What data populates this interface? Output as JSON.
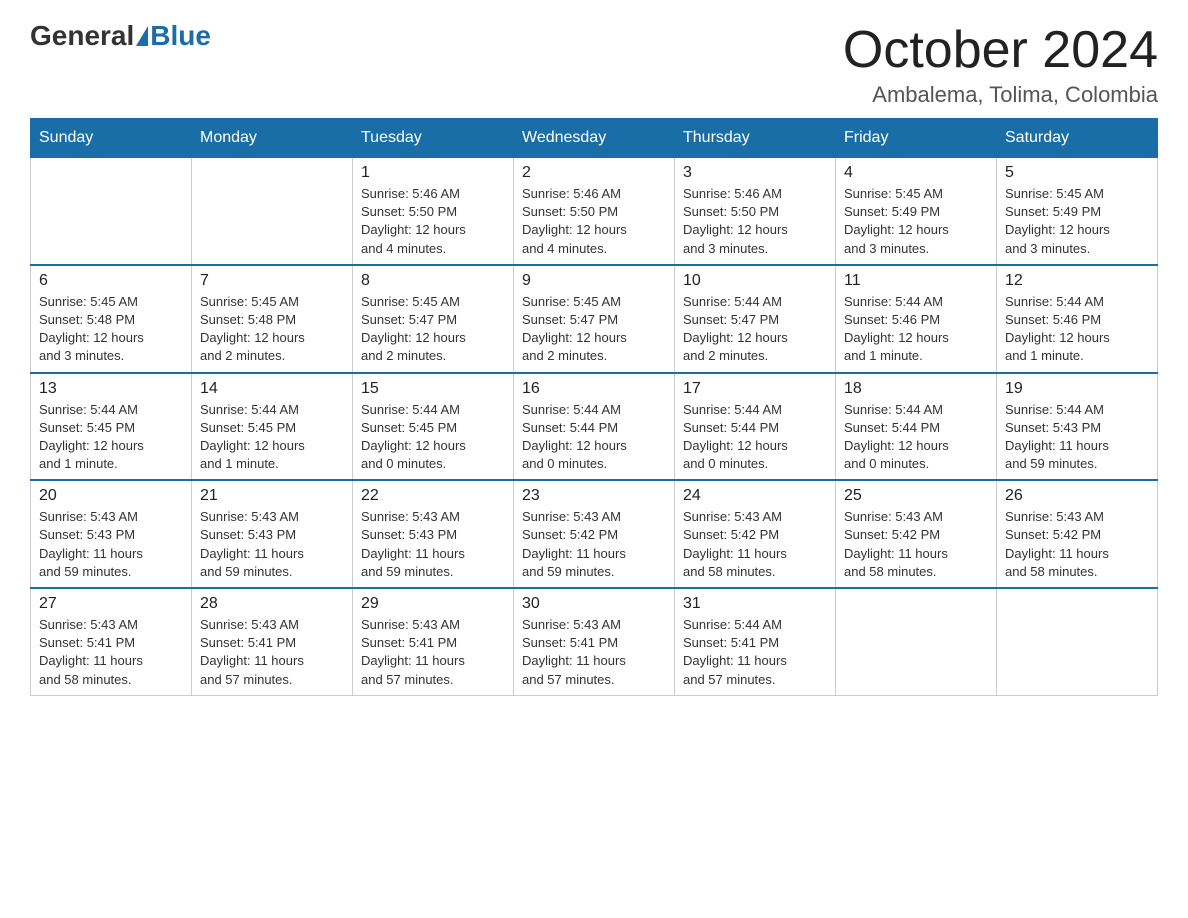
{
  "header": {
    "logo": {
      "general": "General",
      "blue": "Blue"
    },
    "title": "October 2024",
    "location": "Ambalema, Tolima, Colombia"
  },
  "weekdays": [
    "Sunday",
    "Monday",
    "Tuesday",
    "Wednesday",
    "Thursday",
    "Friday",
    "Saturday"
  ],
  "weeks": [
    [
      {
        "day": "",
        "info": ""
      },
      {
        "day": "",
        "info": ""
      },
      {
        "day": "1",
        "info": "Sunrise: 5:46 AM\nSunset: 5:50 PM\nDaylight: 12 hours\nand 4 minutes."
      },
      {
        "day": "2",
        "info": "Sunrise: 5:46 AM\nSunset: 5:50 PM\nDaylight: 12 hours\nand 4 minutes."
      },
      {
        "day": "3",
        "info": "Sunrise: 5:46 AM\nSunset: 5:50 PM\nDaylight: 12 hours\nand 3 minutes."
      },
      {
        "day": "4",
        "info": "Sunrise: 5:45 AM\nSunset: 5:49 PM\nDaylight: 12 hours\nand 3 minutes."
      },
      {
        "day": "5",
        "info": "Sunrise: 5:45 AM\nSunset: 5:49 PM\nDaylight: 12 hours\nand 3 minutes."
      }
    ],
    [
      {
        "day": "6",
        "info": "Sunrise: 5:45 AM\nSunset: 5:48 PM\nDaylight: 12 hours\nand 3 minutes."
      },
      {
        "day": "7",
        "info": "Sunrise: 5:45 AM\nSunset: 5:48 PM\nDaylight: 12 hours\nand 2 minutes."
      },
      {
        "day": "8",
        "info": "Sunrise: 5:45 AM\nSunset: 5:47 PM\nDaylight: 12 hours\nand 2 minutes."
      },
      {
        "day": "9",
        "info": "Sunrise: 5:45 AM\nSunset: 5:47 PM\nDaylight: 12 hours\nand 2 minutes."
      },
      {
        "day": "10",
        "info": "Sunrise: 5:44 AM\nSunset: 5:47 PM\nDaylight: 12 hours\nand 2 minutes."
      },
      {
        "day": "11",
        "info": "Sunrise: 5:44 AM\nSunset: 5:46 PM\nDaylight: 12 hours\nand 1 minute."
      },
      {
        "day": "12",
        "info": "Sunrise: 5:44 AM\nSunset: 5:46 PM\nDaylight: 12 hours\nand 1 minute."
      }
    ],
    [
      {
        "day": "13",
        "info": "Sunrise: 5:44 AM\nSunset: 5:45 PM\nDaylight: 12 hours\nand 1 minute."
      },
      {
        "day": "14",
        "info": "Sunrise: 5:44 AM\nSunset: 5:45 PM\nDaylight: 12 hours\nand 1 minute."
      },
      {
        "day": "15",
        "info": "Sunrise: 5:44 AM\nSunset: 5:45 PM\nDaylight: 12 hours\nand 0 minutes."
      },
      {
        "day": "16",
        "info": "Sunrise: 5:44 AM\nSunset: 5:44 PM\nDaylight: 12 hours\nand 0 minutes."
      },
      {
        "day": "17",
        "info": "Sunrise: 5:44 AM\nSunset: 5:44 PM\nDaylight: 12 hours\nand 0 minutes."
      },
      {
        "day": "18",
        "info": "Sunrise: 5:44 AM\nSunset: 5:44 PM\nDaylight: 12 hours\nand 0 minutes."
      },
      {
        "day": "19",
        "info": "Sunrise: 5:44 AM\nSunset: 5:43 PM\nDaylight: 11 hours\nand 59 minutes."
      }
    ],
    [
      {
        "day": "20",
        "info": "Sunrise: 5:43 AM\nSunset: 5:43 PM\nDaylight: 11 hours\nand 59 minutes."
      },
      {
        "day": "21",
        "info": "Sunrise: 5:43 AM\nSunset: 5:43 PM\nDaylight: 11 hours\nand 59 minutes."
      },
      {
        "day": "22",
        "info": "Sunrise: 5:43 AM\nSunset: 5:43 PM\nDaylight: 11 hours\nand 59 minutes."
      },
      {
        "day": "23",
        "info": "Sunrise: 5:43 AM\nSunset: 5:42 PM\nDaylight: 11 hours\nand 59 minutes."
      },
      {
        "day": "24",
        "info": "Sunrise: 5:43 AM\nSunset: 5:42 PM\nDaylight: 11 hours\nand 58 minutes."
      },
      {
        "day": "25",
        "info": "Sunrise: 5:43 AM\nSunset: 5:42 PM\nDaylight: 11 hours\nand 58 minutes."
      },
      {
        "day": "26",
        "info": "Sunrise: 5:43 AM\nSunset: 5:42 PM\nDaylight: 11 hours\nand 58 minutes."
      }
    ],
    [
      {
        "day": "27",
        "info": "Sunrise: 5:43 AM\nSunset: 5:41 PM\nDaylight: 11 hours\nand 58 minutes."
      },
      {
        "day": "28",
        "info": "Sunrise: 5:43 AM\nSunset: 5:41 PM\nDaylight: 11 hours\nand 57 minutes."
      },
      {
        "day": "29",
        "info": "Sunrise: 5:43 AM\nSunset: 5:41 PM\nDaylight: 11 hours\nand 57 minutes."
      },
      {
        "day": "30",
        "info": "Sunrise: 5:43 AM\nSunset: 5:41 PM\nDaylight: 11 hours\nand 57 minutes."
      },
      {
        "day": "31",
        "info": "Sunrise: 5:44 AM\nSunset: 5:41 PM\nDaylight: 11 hours\nand 57 minutes."
      },
      {
        "day": "",
        "info": ""
      },
      {
        "day": "",
        "info": ""
      }
    ]
  ]
}
